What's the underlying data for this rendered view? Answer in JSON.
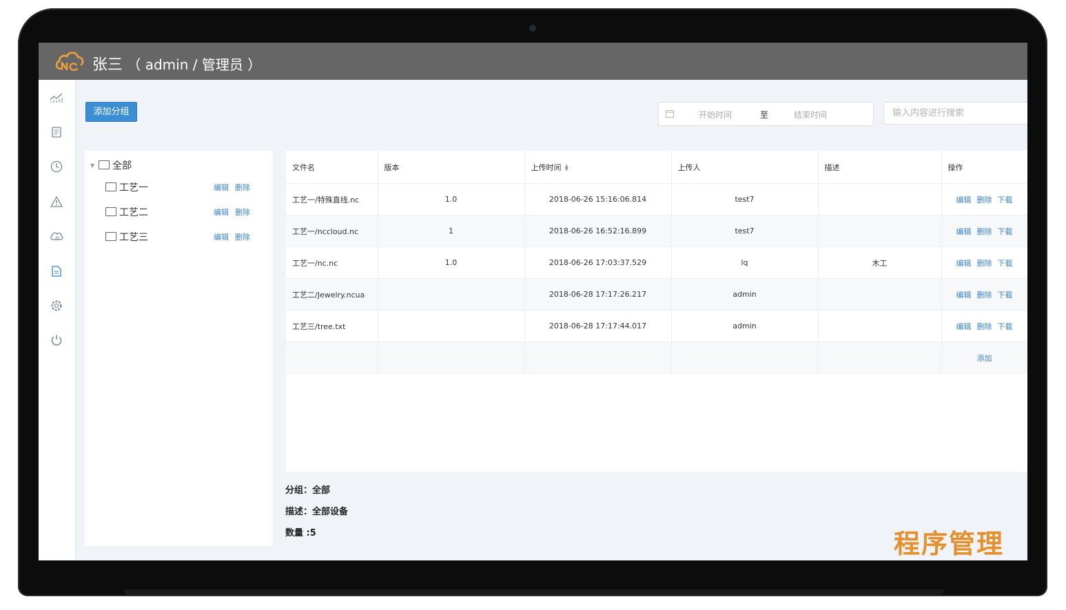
{
  "header": {
    "user_name": "张三",
    "user_role": "（ admin / 管理员 ）"
  },
  "sidebar": {
    "icons": [
      "stats-icon",
      "document-list-icon",
      "clock-icon",
      "warning-icon",
      "cloud-icon",
      "file-icon",
      "settings-icon",
      "power-icon"
    ]
  },
  "toolbar": {
    "add_group_label": "添加分组",
    "date_start_placeholder": "开始时间",
    "date_separator": "至",
    "date_end_placeholder": "结束时间",
    "search_placeholder": "输入内容进行搜索"
  },
  "tree": {
    "root_label": "全部",
    "edit_label": "编辑",
    "delete_label": "删除",
    "nodes": [
      {
        "label": "工艺一"
      },
      {
        "label": "工艺二"
      },
      {
        "label": "工艺三"
      }
    ]
  },
  "table": {
    "columns": [
      "文件名",
      "版本",
      "上传时间",
      "上传人",
      "描述",
      "操作"
    ],
    "action_edit": "编辑",
    "action_delete": "删除",
    "action_download": "下载",
    "add_label": "添加",
    "rows": [
      {
        "file": "工艺一/特殊直线.nc",
        "version": "1.0",
        "time": "2018-06-26 15:16:06.814",
        "uploader": "test7",
        "desc": ""
      },
      {
        "file": "工艺一/nccloud.nc",
        "version": "1",
        "time": "2018-06-26 16:52:16.899",
        "uploader": "test7",
        "desc": ""
      },
      {
        "file": "工艺一/nc.nc",
        "version": "1.0",
        "time": "2018-06-26 17:03:37.529",
        "uploader": "lq",
        "desc": "木工"
      },
      {
        "file": "工艺二/Jewelry.ncua",
        "version": "",
        "time": "2018-06-28 17:17:26.217",
        "uploader": "admin",
        "desc": ""
      },
      {
        "file": "工艺三/tree.txt",
        "version": "",
        "time": "2018-06-28 17:17:44.017",
        "uploader": "admin",
        "desc": ""
      }
    ]
  },
  "info": {
    "group": "分组：全部",
    "description": "描述：全部设备",
    "count": "数量 :5"
  },
  "watermark": "程序管理",
  "colors": {
    "header_bg": "#666667",
    "primary_button": "#3b8ed4",
    "link": "#3c84c9",
    "watermark": "#e3902f",
    "logo": "#f0a23c"
  }
}
